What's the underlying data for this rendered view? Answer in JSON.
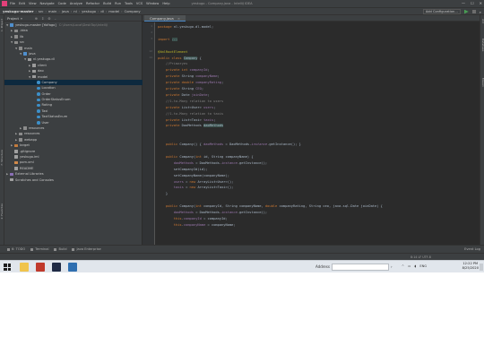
{
  "menubar": {
    "items": [
      "File",
      "Edit",
      "View",
      "Navigate",
      "Code",
      "Analyze",
      "Refactor",
      "Build",
      "Run",
      "Tools",
      "VCS",
      "Window",
      "Help"
    ],
    "title": "yeskugo - Company.java - IntelliJ IDEA"
  },
  "navbar": {
    "crumbs": [
      "yeskugo-master",
      "src",
      "main",
      "java",
      "nl",
      "yeskugo",
      "dl",
      "model",
      "Company"
    ]
  },
  "toolbar": {
    "config_label": "Add Configuration..."
  },
  "project_panel": {
    "header": "Project",
    "tree": [
      {
        "label": "yeskugo-master [Yolfago]",
        "hint": "C:\\Users\\Local\\DeskTop\\IntelliJ",
        "indent": 0,
        "arrow": "▼",
        "icon": "module"
      },
      {
        "label": ".idea",
        "indent": 1,
        "arrow": "▶",
        "icon": "folder"
      },
      {
        "label": "lib",
        "indent": 1,
        "arrow": "▶",
        "icon": "folder"
      },
      {
        "label": "src",
        "indent": 1,
        "arrow": "▼",
        "icon": "folder"
      },
      {
        "label": "main",
        "indent": 2,
        "arrow": "▼",
        "icon": "folder"
      },
      {
        "label": "java",
        "indent": 3,
        "arrow": "▼",
        "icon": "source"
      },
      {
        "label": "nl.yeskugo.dl",
        "indent": 4,
        "arrow": "▼",
        "icon": "package"
      },
      {
        "label": "client",
        "indent": 5,
        "arrow": "▶",
        "icon": "package"
      },
      {
        "label": "dao",
        "indent": 5,
        "arrow": "▶",
        "icon": "package"
      },
      {
        "label": "model",
        "indent": 5,
        "arrow": "▼",
        "icon": "package"
      },
      {
        "label": "Company",
        "indent": 6,
        "arrow": "",
        "icon": "class",
        "selected": true
      },
      {
        "label": "Location",
        "indent": 6,
        "arrow": "",
        "icon": "class"
      },
      {
        "label": "Order",
        "indent": 6,
        "arrow": "",
        "icon": "class"
      },
      {
        "label": "OrderStatusEnum",
        "indent": 6,
        "arrow": "",
        "icon": "class"
      },
      {
        "label": "Rating",
        "indent": 6,
        "arrow": "",
        "icon": "class"
      },
      {
        "label": "Taxi",
        "indent": 6,
        "arrow": "",
        "icon": "class"
      },
      {
        "label": "TaxiStatusEnum",
        "indent": 6,
        "arrow": "",
        "icon": "class"
      },
      {
        "label": "User",
        "indent": 6,
        "arrow": "",
        "icon": "class"
      },
      {
        "label": "resources",
        "indent": 3,
        "arrow": "▶",
        "icon": "folder"
      },
      {
        "label": "resources",
        "indent": 2,
        "arrow": "▶",
        "icon": "folder"
      },
      {
        "label": "webapp",
        "indent": 2,
        "arrow": "▶",
        "icon": "folder"
      },
      {
        "label": "target",
        "indent": 1,
        "arrow": "▶",
        "icon": "target"
      },
      {
        "label": ".gitignore",
        "indent": 1,
        "arrow": "",
        "icon": "file"
      },
      {
        "label": "yeskugo.iml",
        "indent": 1,
        "arrow": "",
        "icon": "file"
      },
      {
        "label": "pom.xml",
        "indent": 1,
        "arrow": "",
        "icon": "xml"
      },
      {
        "label": "README",
        "indent": 1,
        "arrow": "",
        "icon": "file"
      },
      {
        "label": "External Libraries",
        "indent": 0,
        "arrow": "▶",
        "icon": "library"
      },
      {
        "label": "Scratches and Consoles",
        "indent": 0,
        "arrow": "",
        "icon": "file"
      }
    ]
  },
  "editor": {
    "tab": "Company.java",
    "code": [
      {
        "n": "1",
        "segs": [
          {
            "t": "package ",
            "c": "k"
          },
          {
            "t": "nl.yeskugo.dl.model;",
            "c": ""
          }
        ]
      },
      {
        "n": "2",
        "segs": []
      },
      {
        "n": "3",
        "segs": [
          {
            "t": "import ",
            "c": "k"
          },
          {
            "t": "...",
            "c": "hl"
          }
        ]
      },
      {
        "n": "",
        "segs": []
      },
      {
        "n": "12",
        "segs": [
          {
            "t": "@XmlRootElement",
            "c": "ann"
          }
        ]
      },
      {
        "n": "14",
        "segs": [
          {
            "t": "public class ",
            "c": "k"
          },
          {
            "t": "Company",
            "c": "hl"
          },
          {
            "t": " {",
            "c": ""
          }
        ]
      },
      {
        "n": "",
        "segs": [
          {
            "t": "    //Primaryes",
            "c": "cmt"
          }
        ]
      },
      {
        "n": "",
        "segs": [
          {
            "t": "    private int ",
            "c": "k"
          },
          {
            "t": "companyId",
            "c": "fld"
          },
          {
            "t": ";",
            "c": ""
          }
        ]
      },
      {
        "n": "",
        "segs": [
          {
            "t": "    private ",
            "c": "k"
          },
          {
            "t": "String ",
            "c": ""
          },
          {
            "t": "companyName",
            "c": "fld"
          },
          {
            "t": ";",
            "c": ""
          }
        ]
      },
      {
        "n": "",
        "segs": [
          {
            "t": "    private double ",
            "c": "k"
          },
          {
            "t": "companyRating",
            "c": "fld"
          },
          {
            "t": ";",
            "c": ""
          }
        ]
      },
      {
        "n": "",
        "segs": [
          {
            "t": "    private ",
            "c": "k"
          },
          {
            "t": "String ",
            "c": ""
          },
          {
            "t": "CEO",
            "c": "fld"
          },
          {
            "t": ";",
            "c": ""
          }
        ]
      },
      {
        "n": "",
        "segs": [
          {
            "t": "    private ",
            "c": "k"
          },
          {
            "t": "Date ",
            "c": ""
          },
          {
            "t": "joinDate",
            "c": "fld"
          },
          {
            "t": ";",
            "c": ""
          }
        ]
      },
      {
        "n": "",
        "segs": [
          {
            "t": "    //1-to-Many relation to users",
            "c": "cmt"
          }
        ]
      },
      {
        "n": "",
        "segs": [
          {
            "t": "    private ",
            "c": "k"
          },
          {
            "t": "List<User> ",
            "c": ""
          },
          {
            "t": "users",
            "c": "fld"
          },
          {
            "t": ";",
            "c": ""
          }
        ]
      },
      {
        "n": "",
        "segs": [
          {
            "t": "    //1-to-Many relation to taxis",
            "c": "cmt"
          }
        ]
      },
      {
        "n": "",
        "segs": [
          {
            "t": "    private ",
            "c": "k"
          },
          {
            "t": "List<Taxi> ",
            "c": ""
          },
          {
            "t": "taxis",
            "c": "fld"
          },
          {
            "t": ";",
            "c": ""
          }
        ]
      },
      {
        "n": "",
        "segs": [
          {
            "t": "    private ",
            "c": "k"
          },
          {
            "t": "DaoMethods ",
            "c": ""
          },
          {
            "t": "daoMethods",
            "c": "hl"
          }
        ]
      },
      {
        "n": "",
        "segs": []
      },
      {
        "n": "",
        "segs": []
      },
      {
        "n": "",
        "segs": [
          {
            "t": "    public ",
            "c": "k"
          },
          {
            "t": "Company() { ",
            "c": ""
          },
          {
            "t": "daoMethods",
            "c": "fld"
          },
          {
            "t": " = DaoMethods.",
            "c": ""
          },
          {
            "t": "instance",
            "c": "it"
          },
          {
            "t": ".getInstance(); }",
            "c": ""
          }
        ]
      },
      {
        "n": "",
        "segs": []
      },
      {
        "n": "",
        "segs": [
          {
            "t": "    public ",
            "c": "k"
          },
          {
            "t": "Company(",
            "c": ""
          },
          {
            "t": "int ",
            "c": "k"
          },
          {
            "t": "id, String companyName) {",
            "c": ""
          }
        ]
      },
      {
        "n": "",
        "segs": [
          {
            "t": "        daoMethods",
            "c": "fld"
          },
          {
            "t": " = DaoMethods.",
            "c": ""
          },
          {
            "t": "instance",
            "c": "it"
          },
          {
            "t": ".getInstance();",
            "c": ""
          }
        ]
      },
      {
        "n": "",
        "segs": [
          {
            "t": "        setCompanyId(id);",
            "c": ""
          }
        ]
      },
      {
        "n": "",
        "segs": [
          {
            "t": "        setCompanyName(companyName);",
            "c": ""
          }
        ]
      },
      {
        "n": "",
        "segs": [
          {
            "t": "        users",
            "c": "fld"
          },
          {
            "t": " = ",
            "c": ""
          },
          {
            "t": "new ",
            "c": "k"
          },
          {
            "t": "ArrayList<User>();",
            "c": ""
          }
        ]
      },
      {
        "n": "",
        "segs": [
          {
            "t": "        taxis",
            "c": "fld"
          },
          {
            "t": " = ",
            "c": ""
          },
          {
            "t": "new ",
            "c": "k"
          },
          {
            "t": "ArrayList<Taxi>();",
            "c": ""
          }
        ]
      },
      {
        "n": "",
        "segs": [
          {
            "t": "    }",
            "c": ""
          }
        ]
      },
      {
        "n": "",
        "segs": []
      },
      {
        "n": "",
        "segs": [
          {
            "t": "    public ",
            "c": "k"
          },
          {
            "t": "Company(",
            "c": ""
          },
          {
            "t": "int ",
            "c": "k"
          },
          {
            "t": "companyId, String companyName, ",
            "c": ""
          },
          {
            "t": "double ",
            "c": "k"
          },
          {
            "t": "companyRating, String ceo, java.sql.Date joinDate) {",
            "c": ""
          }
        ]
      },
      {
        "n": "",
        "segs": [
          {
            "t": "        daoMethods",
            "c": "fld"
          },
          {
            "t": " = DaoMethods.",
            "c": ""
          },
          {
            "t": "instance",
            "c": "it"
          },
          {
            "t": ".getInstance();",
            "c": ""
          }
        ]
      },
      {
        "n": "",
        "segs": [
          {
            "t": "        this",
            "c": "k"
          },
          {
            "t": ".",
            "c": ""
          },
          {
            "t": "companyId",
            "c": "fld"
          },
          {
            "t": " = companyId;",
            "c": ""
          }
        ]
      },
      {
        "n": "",
        "segs": [
          {
            "t": "        this",
            "c": "k"
          },
          {
            "t": ".",
            "c": ""
          },
          {
            "t": "companyName",
            "c": "fld"
          },
          {
            "t": " = companyName;",
            "c": ""
          }
        ]
      }
    ]
  },
  "bottom_tools": [
    "6: TODO",
    "Terminal",
    "Build",
    "Java Enterprise"
  ],
  "event_log": "Event Log",
  "status": {
    "position": "8:14   LF   UTF-8"
  },
  "taskbar": {
    "address_label": "Address",
    "tray": [
      "ENG"
    ],
    "time": "12:22 PM",
    "date": "8/25/2020"
  },
  "colors": {
    "ide_bg": "#2b2b2b",
    "panel_bg": "#3c3f41",
    "keyword": "#cc7832",
    "field": "#9876aa",
    "selection": "#0d293e",
    "taskbar_bg": "#e1e6ec"
  }
}
